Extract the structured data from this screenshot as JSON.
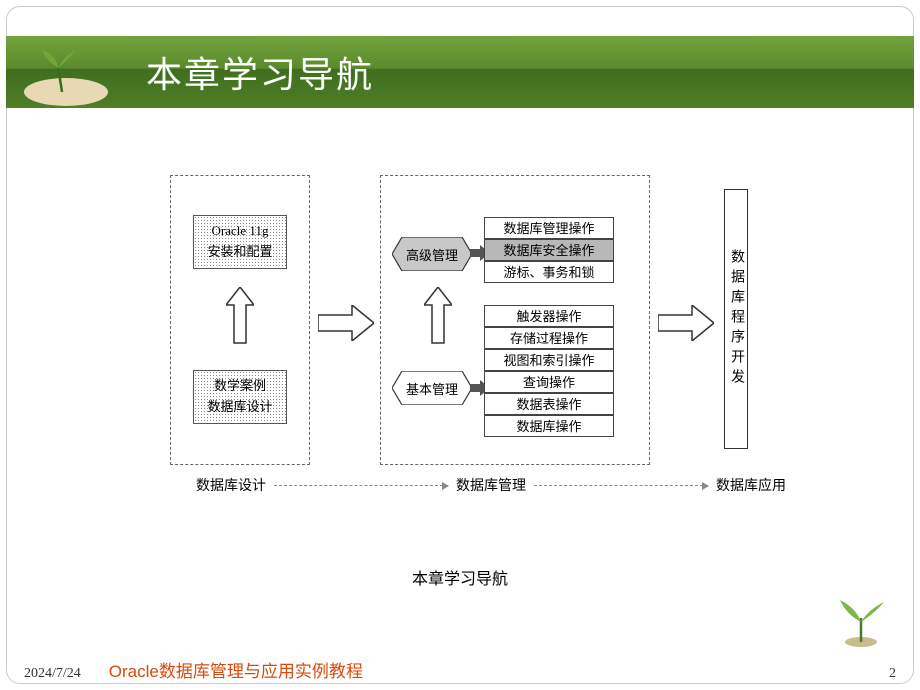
{
  "header": {
    "title": "本章学习导航"
  },
  "diagram": {
    "group1": {
      "box_oracle_l1": "Oracle 11g",
      "box_oracle_l2": "安装和配置",
      "box_case_l1": "数学案例",
      "box_case_l2": "数据库设计"
    },
    "group2": {
      "hex_advanced": "高级管理",
      "hex_basic": "基本管理",
      "adv_items": [
        "数据库管理操作",
        "数据库安全操作",
        "游标、事务和锁"
      ],
      "basic_items": [
        "触发器操作",
        "存储过程操作",
        "视图和索引操作",
        "查询操作",
        "数据表操作",
        "数据库操作"
      ]
    },
    "right_box": "数据库程序开发",
    "bottom": {
      "label1": "数据库设计",
      "label2": "数据库管理",
      "label3": "数据库应用"
    }
  },
  "subtitle": "本章学习导航",
  "footer": {
    "date": "2024/7/24",
    "course": "Oracle数据库管理与应用实例教程",
    "page": "2"
  }
}
